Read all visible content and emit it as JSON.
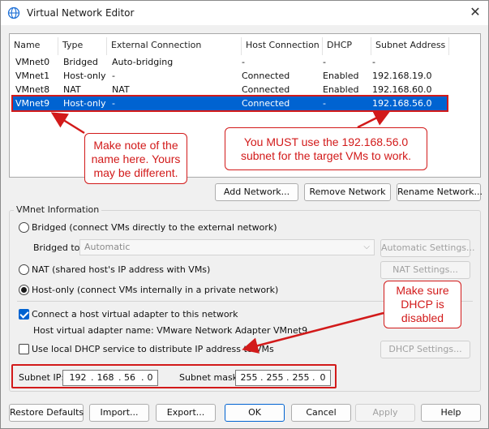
{
  "window": {
    "title": "Virtual Network Editor",
    "close_glyph": "✕",
    "icon": "globe-icon"
  },
  "table": {
    "columns": [
      "Name",
      "Type",
      "External Connection",
      "Host Connection",
      "DHCP",
      "Subnet Address"
    ],
    "rows": [
      [
        "VMnet0",
        "Bridged",
        "Auto-bridging",
        "-",
        "-",
        "-"
      ],
      [
        "VMnet1",
        "Host-only",
        "-",
        "Connected",
        "Enabled",
        "192.168.19.0"
      ],
      [
        "VMnet8",
        "NAT",
        "NAT",
        "Connected",
        "Enabled",
        "192.168.60.0"
      ],
      [
        "VMnet9",
        "Host-only",
        "-",
        "Connected",
        "-",
        "192.168.56.0"
      ]
    ],
    "selected_row": 3
  },
  "table_buttons": {
    "add": "Add Network...",
    "remove": "Remove Network",
    "rename": "Rename Network..."
  },
  "vmnet_info": {
    "group_label": "VMnet Information",
    "bridged_label": "Bridged (connect VMs directly to the external network)",
    "bridged_to_label": "Bridged to:",
    "bridged_to_value": "Automatic",
    "auto_settings": "Automatic Settings...",
    "nat_label": "NAT (shared host's IP address with VMs)",
    "nat_settings": "NAT Settings...",
    "hostonly_label": "Host-only (connect VMs internally in a private network)",
    "selected_mode": "Host-only",
    "connect_adapter_label": "Connect a host virtual adapter to this network",
    "connect_adapter_checked": true,
    "adapter_name_text": "Host virtual adapter name: VMware Network Adapter VMnet9",
    "dhcp_label": "Use local DHCP service to distribute IP address to VMs",
    "dhcp_checked": false,
    "dhcp_settings": "DHCP Settings...",
    "subnet_ip_label": "Subnet IP:",
    "subnet_ip": [
      "192",
      "168",
      "56",
      "0"
    ],
    "subnet_mask_label": "Subnet mask:",
    "subnet_mask": [
      "255",
      "255",
      "255",
      "0"
    ]
  },
  "footer_buttons": {
    "restore": "Restore Defaults",
    "import": "Import...",
    "export": "Export...",
    "ok": "OK",
    "cancel": "Cancel",
    "apply": "Apply",
    "help": "Help"
  },
  "callouts": {
    "name_note": "Make note of the name here. Yours may be different.",
    "subnet_note": "You MUST use the 192.168.56.0 subnet for the target VMs to work.",
    "dhcp_note": "Make sure DHCP is disabled"
  },
  "colors": {
    "annotation_red": "#d21a1a",
    "selection_blue": "#0063d1"
  }
}
